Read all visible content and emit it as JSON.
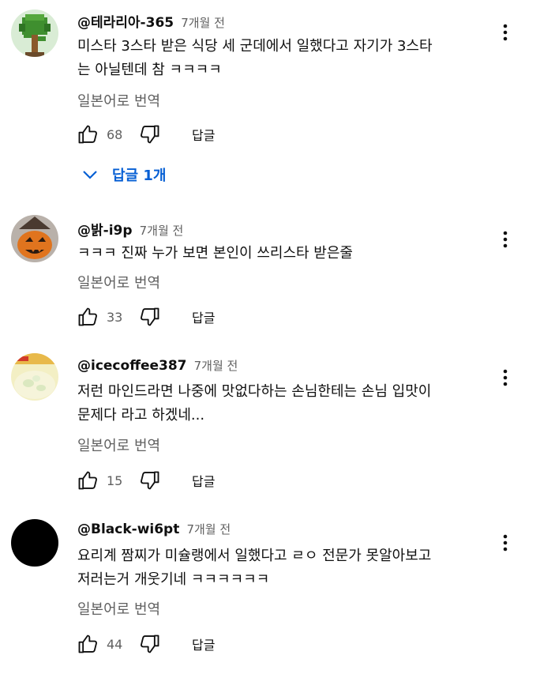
{
  "comments": [
    {
      "handle": "@테라리아-365",
      "time": "7개월 전",
      "text": "미스타 3스타 받은 식당 세 군데에서 일했다고 자기가 3스타\n는 아닐텐데 참 ㅋㅋㅋㅋ",
      "translate": "일본어로 번역",
      "likes": "68",
      "reply": "답글",
      "replies_label": "답글 1개",
      "avatar": "terraria-tree"
    },
    {
      "handle": "@밝-i9p",
      "time": "7개월 전",
      "text": "ㅋㅋㅋ 진짜 누가 보면 본인이 쓰리스타 받은줄",
      "translate": "일본어로 번역",
      "likes": "33",
      "reply": "답글",
      "avatar": "pumpkin"
    },
    {
      "handle": "@icecoffee387",
      "time": "7개월 전",
      "text": "저런 마인드라면 나중에 맛없다하는 손님한테는 손님 입맛이\n문제다 라고 하겠네...",
      "translate": "일본어로 번역",
      "likes": "15",
      "reply": "답글",
      "avatar": "iced-drink"
    },
    {
      "handle": "@Black-wi6pt",
      "time": "7개월 전",
      "text": "요리계 짬찌가 미슐랭에서 일했다고 ㄹㅇ 전문가 못알아보고\n저러는거 개웃기네 ㅋㅋㅋㅋㅋㅋ",
      "translate": "일본어로 번역",
      "likes": "44",
      "reply": "답글",
      "avatar": "black-circle"
    }
  ],
  "colors": {
    "text": "#0f0f0f",
    "secondary": "#606060",
    "link": "#065fd4"
  },
  "icons": [
    "like-icon",
    "dislike-icon",
    "more-vert-icon",
    "chevron-down-icon"
  ]
}
